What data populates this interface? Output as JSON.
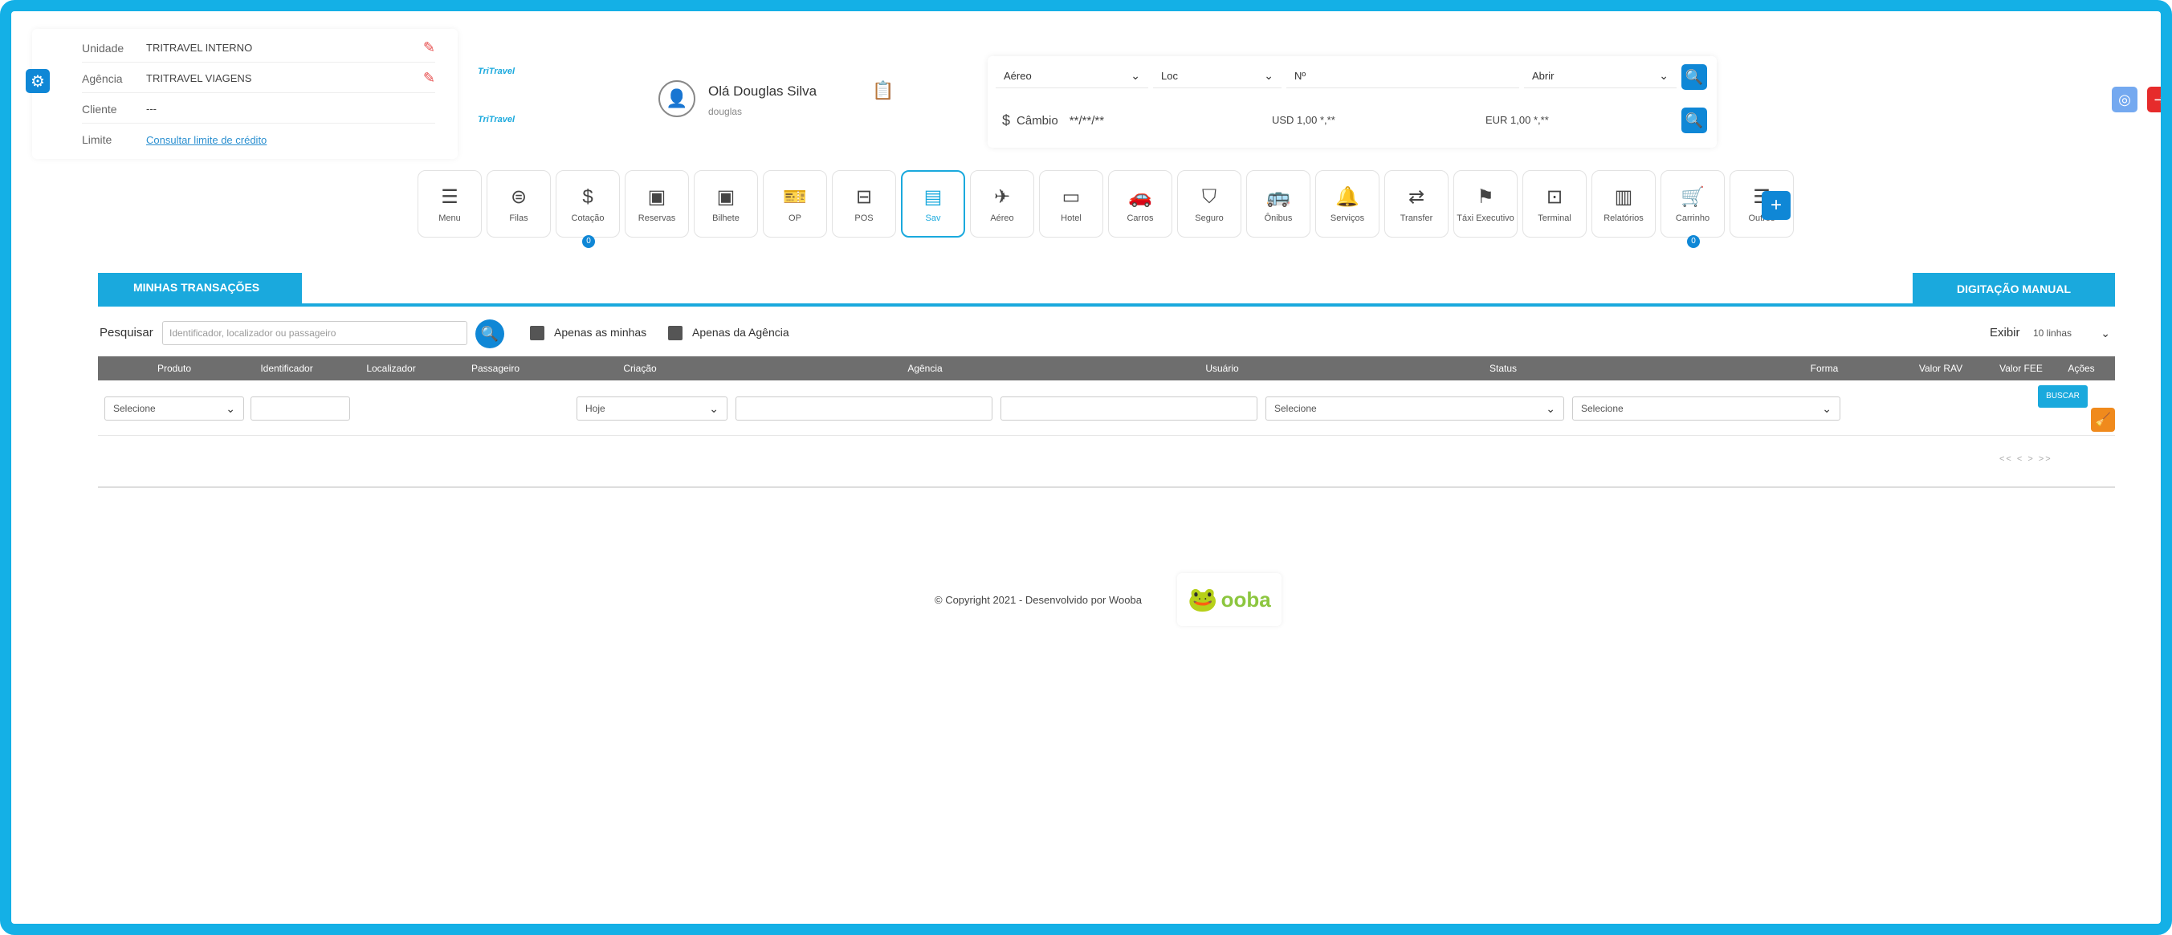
{
  "info": {
    "unidade_label": "Unidade",
    "unidade_value": "TRITRAVEL INTERNO",
    "agencia_label": "Agência",
    "agencia_value": "TRITRAVEL VIAGENS",
    "cliente_label": "Cliente",
    "cliente_value": "---",
    "limite_label": "Limite",
    "limite_link": "Consultar limite de crédito"
  },
  "logos": [
    "TriTravel",
    "TriTravel"
  ],
  "user": {
    "greeting": "Olá Douglas Silva",
    "login": "douglas"
  },
  "search_panel": {
    "product": "Aéreo",
    "field": "Loc",
    "number_placeholder": "Nº",
    "action": "Abrir",
    "cambio_label": "Câmbio",
    "cambio_value": "**/**/**",
    "usd": "USD 1,00 *,**",
    "eur": "EUR 1,00 *,**"
  },
  "toolbar": [
    {
      "label": "Menu",
      "icon": "☰"
    },
    {
      "label": "Filas",
      "icon": "⊜"
    },
    {
      "label": "Cotação",
      "icon": "$",
      "badge": "0"
    },
    {
      "label": "Reservas",
      "icon": "▣"
    },
    {
      "label": "Bilhete",
      "icon": "▣"
    },
    {
      "label": "OP",
      "icon": "🎫"
    },
    {
      "label": "POS",
      "icon": "⊟"
    },
    {
      "label": "Sav",
      "icon": "▤",
      "active": true
    },
    {
      "label": "Aéreo",
      "icon": "✈"
    },
    {
      "label": "Hotel",
      "icon": "▭"
    },
    {
      "label": "Carros",
      "icon": "🚗"
    },
    {
      "label": "Seguro",
      "icon": "⛉"
    },
    {
      "label": "Ônibus",
      "icon": "🚌"
    },
    {
      "label": "Serviços",
      "icon": "🔔"
    },
    {
      "label": "Transfer",
      "icon": "⇄"
    },
    {
      "label": "Táxi Executivo",
      "icon": "⚑"
    },
    {
      "label": "Terminal",
      "icon": "⊡"
    },
    {
      "label": "Relatórios",
      "icon": "▥"
    },
    {
      "label": "Carrinho",
      "icon": "🛒",
      "badge": "0"
    },
    {
      "label": "Outros",
      "icon": "☰"
    }
  ],
  "tabs": {
    "minhas": "MINHAS TRANSAÇÕES",
    "digitacao": "DIGITAÇÃO MANUAL"
  },
  "search": {
    "label": "Pesquisar",
    "placeholder": "Identificador, localizador ou passageiro",
    "check1": "Apenas as minhas",
    "check2": "Apenas da Agência",
    "exibe_label": "Exibir",
    "exibe_value": "10 linhas"
  },
  "table": {
    "headers": [
      "Produto",
      "Identificador",
      "Localizador",
      "Passageiro",
      "Criação",
      "Agência",
      "Usuário",
      "Status",
      "Forma",
      "Valor RAV",
      "Valor FEE",
      "Ações"
    ],
    "filter_produto": "Selecione",
    "filter_criacao": "Hoje",
    "filter_status": "Selecione",
    "filter_forma": "Selecione",
    "buscar": "BUSCAR",
    "pager": "<< < > >>"
  },
  "footer": {
    "copyright": "© Copyright 2021 - Desenvolvido por Wooba",
    "logo_text": "ooba"
  },
  "colors": {
    "accent": "#1aa9dd",
    "primary": "#0f87d6",
    "danger": "#e62b2b",
    "warning": "#f08a1c",
    "header_gray": "#6e6e6e"
  }
}
